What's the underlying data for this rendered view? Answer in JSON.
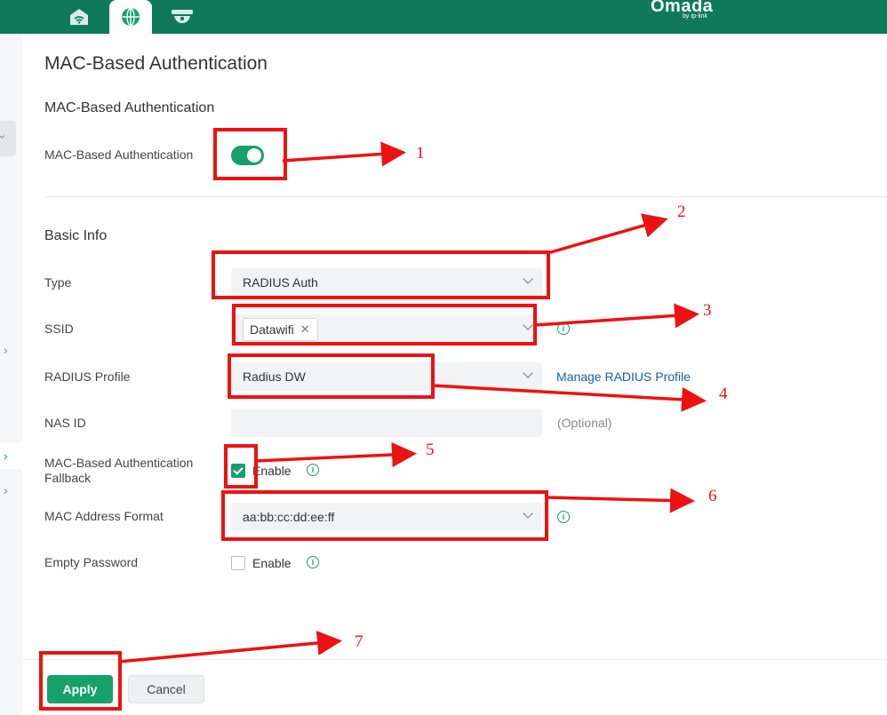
{
  "header": {
    "logo": "Omada",
    "logo_sub": "by tp-link",
    "tabs": [
      {
        "icon": "home-network-icon"
      },
      {
        "icon": "globe-icon"
      },
      {
        "icon": "camera-dome-icon"
      }
    ]
  },
  "page": {
    "title": "MAC-Based Authentication"
  },
  "mac_auth": {
    "section_title": "MAC-Based Authentication",
    "toggle_label": "MAC-Based Authentication",
    "toggle_on": true
  },
  "basic_info": {
    "section_title": "Basic Info",
    "type_label": "Type",
    "type_value": "RADIUS Auth",
    "ssid_label": "SSID",
    "ssid_chip": "Datawifi",
    "radius_label": "RADIUS Profile",
    "radius_value": "Radius DW",
    "manage_link": "Manage RADIUS Profile",
    "nas_label": "NAS ID",
    "nas_value": "",
    "nas_hint": "(Optional)",
    "fallback_label_1": "MAC-Based Authentication",
    "fallback_label_2": "Fallback",
    "fallback_enable": "Enable",
    "fallback_checked": true,
    "format_label": "MAC Address Format",
    "format_value": "aa:bb:cc:dd:ee:ff",
    "empty_pw_label": "Empty Password",
    "empty_pw_enable": "Enable",
    "empty_pw_checked": false
  },
  "footer": {
    "apply": "Apply",
    "cancel": "Cancel"
  },
  "annotations": [
    "1",
    "2",
    "3",
    "4",
    "5",
    "6",
    "7"
  ],
  "colors": {
    "brand": "#0f7a5a",
    "accent": "#17a06b",
    "annotation": "#ee1111",
    "link": "#1a5ea8"
  }
}
